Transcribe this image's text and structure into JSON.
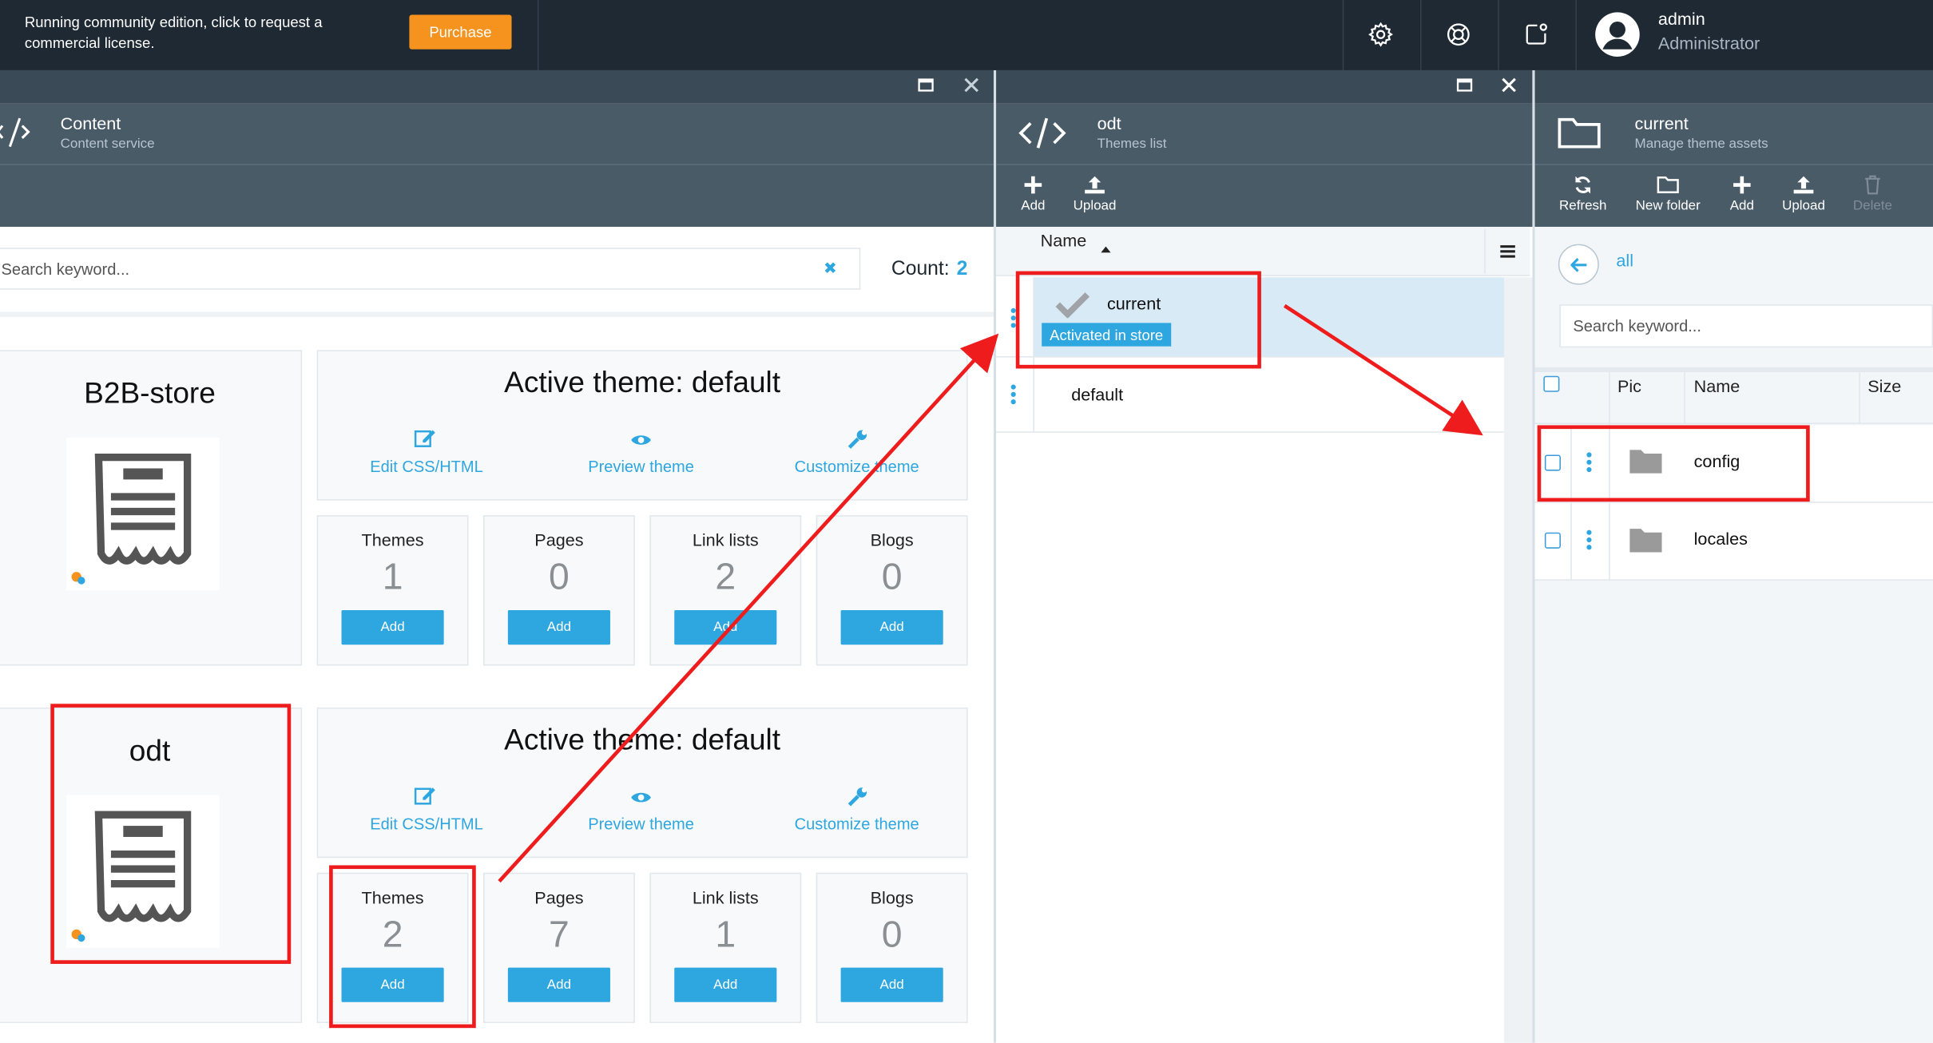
{
  "topbar": {
    "license_text": "Running community edition, click to request a commercial license.",
    "purchase_label": "Purchase",
    "icons": [
      "gear-icon",
      "lifebuoy-icon",
      "notification-icon"
    ],
    "user": {
      "name": "admin",
      "role": "Administrator"
    }
  },
  "content_blade": {
    "title": "Content",
    "subtitle": "Content service",
    "search_placeholder": "Search keyword...",
    "count_label": "Count:",
    "count_value": "2",
    "stores": [
      {
        "name": "B2B-store",
        "active_theme": "Active theme: default",
        "links": [
          "Edit CSS/HTML",
          "Preview theme",
          "Customize theme"
        ],
        "stats": [
          {
            "title": "Themes",
            "value": "1",
            "button": "Add"
          },
          {
            "title": "Pages",
            "value": "0",
            "button": "Add"
          },
          {
            "title": "Link lists",
            "value": "2",
            "button": "Add"
          },
          {
            "title": "Blogs",
            "value": "0",
            "button": "Add"
          }
        ]
      },
      {
        "name": "odt",
        "active_theme": "Active theme: default",
        "links": [
          "Edit CSS/HTML",
          "Preview theme",
          "Customize theme"
        ],
        "stats": [
          {
            "title": "Themes",
            "value": "2",
            "button": "Add"
          },
          {
            "title": "Pages",
            "value": "7",
            "button": "Add"
          },
          {
            "title": "Link lists",
            "value": "1",
            "button": "Add"
          },
          {
            "title": "Blogs",
            "value": "0",
            "button": "Add"
          }
        ]
      }
    ]
  },
  "themes_blade": {
    "title": "odt",
    "subtitle": "Themes list",
    "toolbar": [
      "Add",
      "Upload"
    ],
    "column_name": "Name",
    "rows": [
      {
        "name": "current",
        "badge": "Activated in store"
      },
      {
        "name": "default"
      }
    ]
  },
  "assets_blade": {
    "title": "current",
    "subtitle": "Manage theme assets",
    "toolbar": [
      "Refresh",
      "New folder",
      "Add",
      "Upload",
      "Delete"
    ],
    "breadcrumb": "all",
    "search_placeholder": "Search keyword...",
    "columns": [
      "Pic",
      "Name",
      "Size"
    ],
    "rows": [
      {
        "name": "config"
      },
      {
        "name": "locales"
      }
    ]
  },
  "colors": {
    "accent": "#2ea6e0",
    "purchase": "#f6921e",
    "annotation": "#ee1c1c",
    "topbar": "#1e2933"
  }
}
